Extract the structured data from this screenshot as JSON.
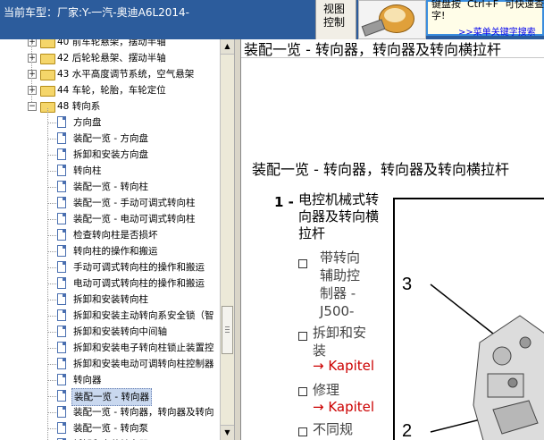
{
  "header": {
    "car_title": "当前车型：厂家:Y-一汽-奥迪A6L2014-",
    "view_ctrl_line1": "视图",
    "view_ctrl_line2": "控制",
    "tip_text": "键盘按  Ctrl+F  可快速查找\n字!",
    "tip_link": ">>菜单关键字搜索"
  },
  "tree": {
    "nodes": [
      {
        "label": "40 前车轮悬架，摆动半轴",
        "kind": "folder",
        "level": 1,
        "expanded": false
      },
      {
        "label": "42 后轮轮悬架、摆动半轴",
        "kind": "folder",
        "level": 1,
        "expanded": false
      },
      {
        "label": "43 水平高度调节系统，空气悬架",
        "kind": "folder",
        "level": 1,
        "expanded": false
      },
      {
        "label": "44 车轮，轮胎，车轮定位",
        "kind": "folder",
        "level": 1,
        "expanded": false
      },
      {
        "label": "48 转向系",
        "kind": "folder",
        "level": 1,
        "expanded": true
      },
      {
        "label": "方向盘",
        "kind": "doc",
        "level": 2
      },
      {
        "label": "装配一览 - 方向盘",
        "kind": "doc",
        "level": 2
      },
      {
        "label": "拆卸和安装方向盘",
        "kind": "doc",
        "level": 2
      },
      {
        "label": "转向柱",
        "kind": "doc",
        "level": 2
      },
      {
        "label": "装配一览 - 转向柱",
        "kind": "doc",
        "level": 2
      },
      {
        "label": "装配一览 - 手动可调式转向柱",
        "kind": "doc",
        "level": 2
      },
      {
        "label": "装配一览 - 电动可调式转向柱",
        "kind": "doc",
        "level": 2
      },
      {
        "label": "检查转向柱是否损坏",
        "kind": "doc",
        "level": 2
      },
      {
        "label": "转向柱的操作和搬运",
        "kind": "doc",
        "level": 2
      },
      {
        "label": "手动可调式转向柱的操作和搬运",
        "kind": "doc",
        "level": 2
      },
      {
        "label": "电动可调式转向柱的操作和搬运",
        "kind": "doc",
        "level": 2
      },
      {
        "label": "拆卸和安装转向柱",
        "kind": "doc",
        "level": 2
      },
      {
        "label": "拆卸和安装主动转向系安全锁（智",
        "kind": "doc",
        "level": 2
      },
      {
        "label": "拆卸和安装转向中间轴",
        "kind": "doc",
        "level": 2
      },
      {
        "label": "拆卸和安装电子转向柱锁止装置控",
        "kind": "doc",
        "level": 2
      },
      {
        "label": "拆卸和安装电动可调转向柱控制器",
        "kind": "doc",
        "level": 2
      },
      {
        "label": "转向器",
        "kind": "doc",
        "level": 2
      },
      {
        "label": "装配一览 - 转向器",
        "kind": "doc",
        "level": 2,
        "selected": true
      },
      {
        "label": "装配一览 - 转向器，转向器及转向",
        "kind": "doc",
        "level": 2
      },
      {
        "label": "装配一览 - 转向泵",
        "kind": "doc",
        "level": 2
      },
      {
        "label": "拆卸和安装转向器",
        "kind": "doc",
        "level": 2
      }
    ]
  },
  "content": {
    "head_title": "装配一览 - 转向器，转向器及转向横拉杆",
    "section_title": "装配一览 - 转向器，转向器及转向横拉杆",
    "item1": {
      "num": "1 -",
      "title": "电控机械式转向器及转向横拉杆",
      "bullets": [
        {
          "text_lines": [
            "带转向",
            "辅助控",
            "制器 -",
            "J500-"
          ]
        },
        {
          "text_lines": [
            "拆卸和安",
            "装"
          ],
          "link": "→ Kapitel"
        },
        {
          "text_lines": [
            "修理"
          ],
          "link": "→ Kapitel"
        },
        {
          "text_lines": [
            "不同规"
          ]
        }
      ]
    },
    "callouts": [
      "3",
      "2"
    ]
  }
}
